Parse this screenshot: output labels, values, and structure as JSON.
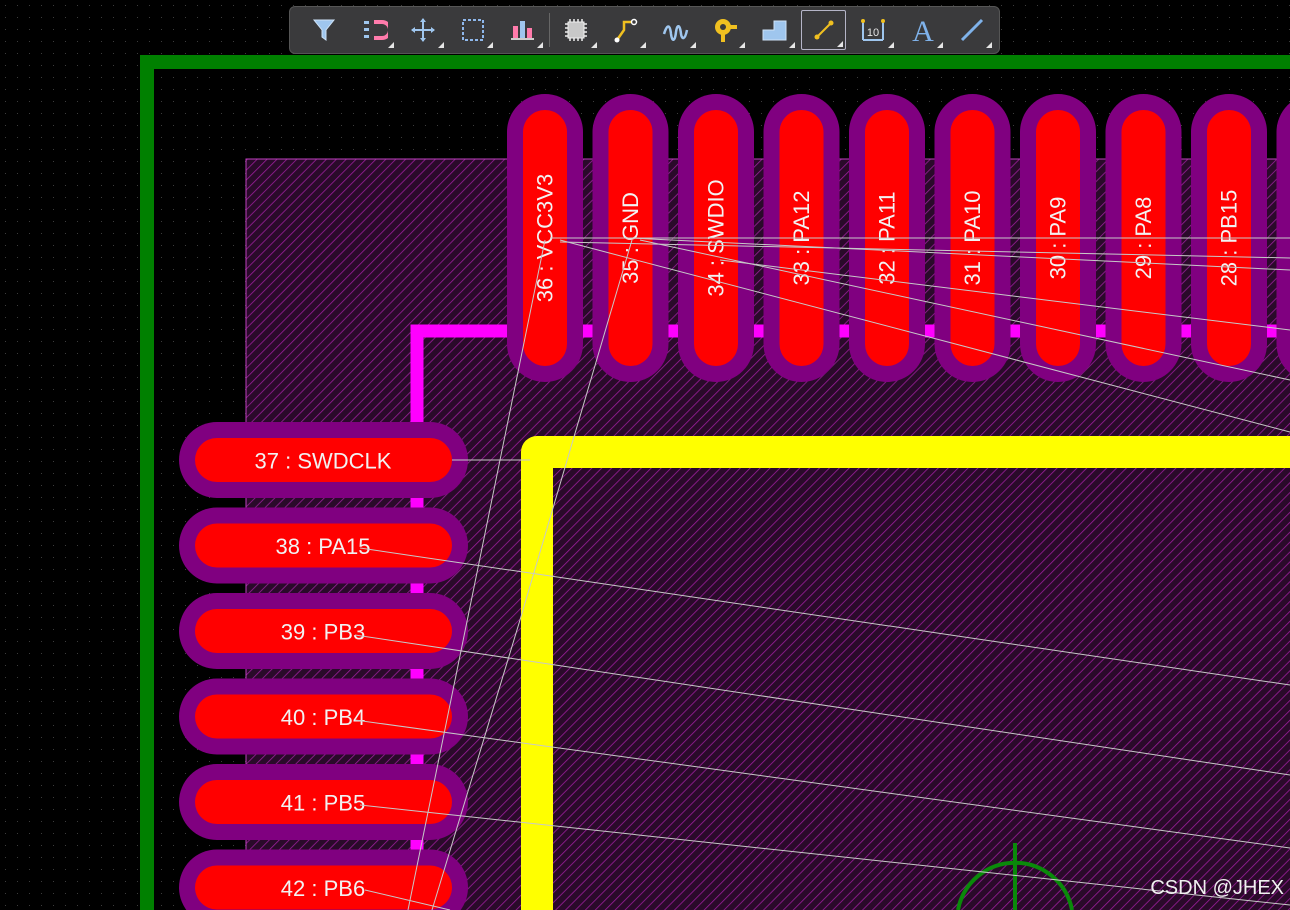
{
  "toolbar": {
    "tools": [
      {
        "name": "filter-icon",
        "label": "Filter"
      },
      {
        "name": "magnet-snap-icon",
        "label": "Snap"
      },
      {
        "name": "move-crosshair-icon",
        "label": "Move"
      },
      {
        "name": "selection-rect-icon",
        "label": "Select"
      },
      {
        "name": "align-distribute-icon",
        "label": "Align"
      },
      {
        "name": "component-chip-icon",
        "label": "Place Component"
      },
      {
        "name": "route-track-icon",
        "label": "Interactive Routing"
      },
      {
        "name": "diff-pair-tune-icon",
        "label": "Length Tuning"
      },
      {
        "name": "via-pad-icon",
        "label": "Place Via"
      },
      {
        "name": "polygon-fill-icon",
        "label": "Polygon Pour"
      },
      {
        "name": "unrouted-net-icon",
        "label": "Unrouted Net",
        "active": true
      },
      {
        "name": "dimension-icon",
        "label": "Dimension",
        "text": "10"
      },
      {
        "name": "text-string-icon",
        "label": "Place String",
        "text": "A"
      },
      {
        "name": "line-icon",
        "label": "Place Line"
      }
    ]
  },
  "pads_top": [
    "36 : VCC3V3",
    "35 : GND",
    "34 : SWDIO",
    "33 : PA12",
    "32 : PA11",
    "31 : PA10",
    "30 : PA9",
    "29 : PA8",
    "28 : PB15"
  ],
  "pads_left": [
    "37 : SWDCLK",
    "38 : PA15",
    "39 : PB3",
    "40 : PB4",
    "41 : PB5",
    "42 : PB6"
  ],
  "watermark": "CSDN @JHEX",
  "colors": {
    "board_outline": "#008000",
    "pad_fill": "#ff0000",
    "pad_mask": "#800080",
    "silkscreen_magenta": "#ff00ff",
    "courtyard_yellow": "#ffff00",
    "ratsnest": "#c8c8c8",
    "hatch": "#9a1e9a"
  }
}
